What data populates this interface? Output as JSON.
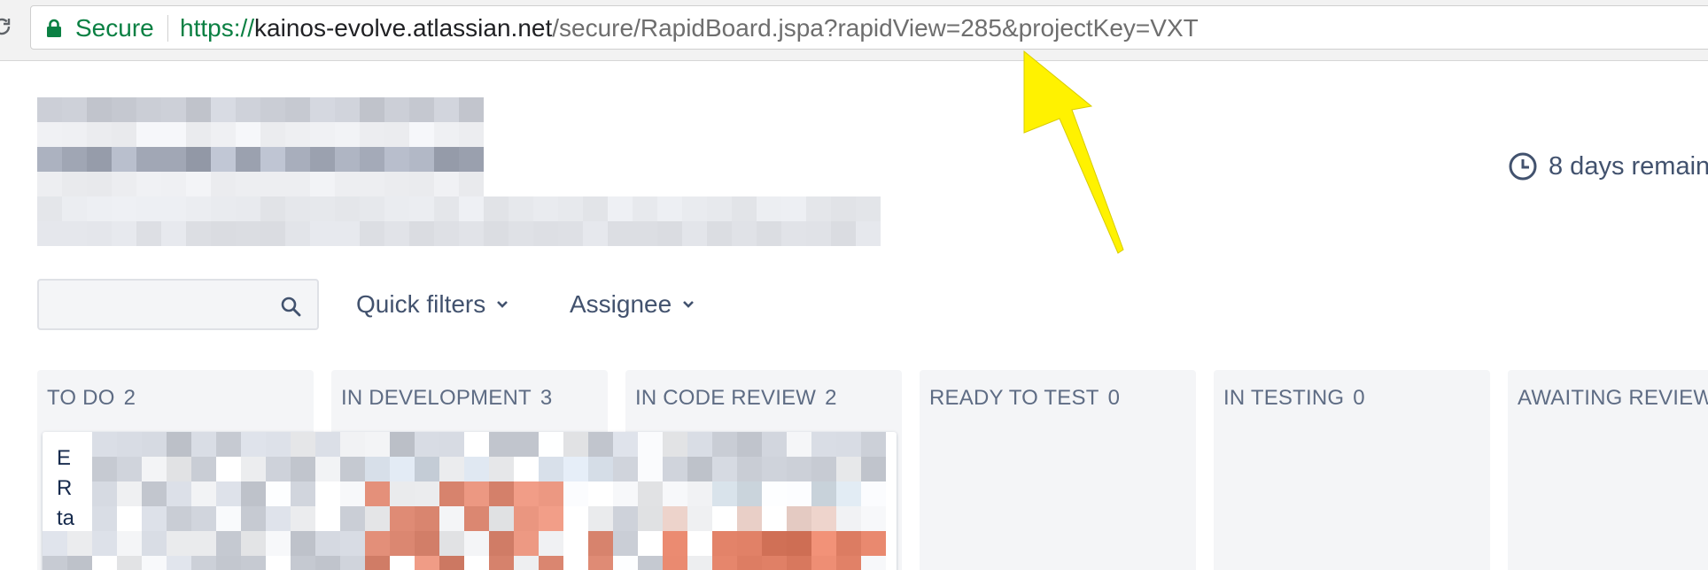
{
  "browser": {
    "secure_label": "Secure",
    "url_scheme": "https://",
    "url_host": "kainos-evolve.atlassian.net",
    "url_path": "/secure/RapidBoard.jspa?rapidView=285&projectKey=VXT"
  },
  "board": {
    "time_remaining": "8 days remain"
  },
  "toolbar": {
    "search_placeholder": "",
    "quick_filters_label": "Quick filters",
    "assignee_label": "Assignee"
  },
  "columns": [
    {
      "title": "TO DO",
      "count": "2"
    },
    {
      "title": "IN DEVELOPMENT",
      "count": "3"
    },
    {
      "title": "IN CODE REVIEW",
      "count": "2"
    },
    {
      "title": "READY TO TEST",
      "count": "0"
    },
    {
      "title": "IN TESTING",
      "count": "0"
    },
    {
      "title": "AWAITING REVIEW",
      "count": ""
    }
  ],
  "cards": {
    "visible_letters": [
      "E",
      "R",
      "ta"
    ]
  },
  "colors": {
    "secure_green": "#0b8043",
    "annotation_arrow": "#fff200",
    "column_bg": "#f4f5f7",
    "header_text": "#5e6c84"
  }
}
